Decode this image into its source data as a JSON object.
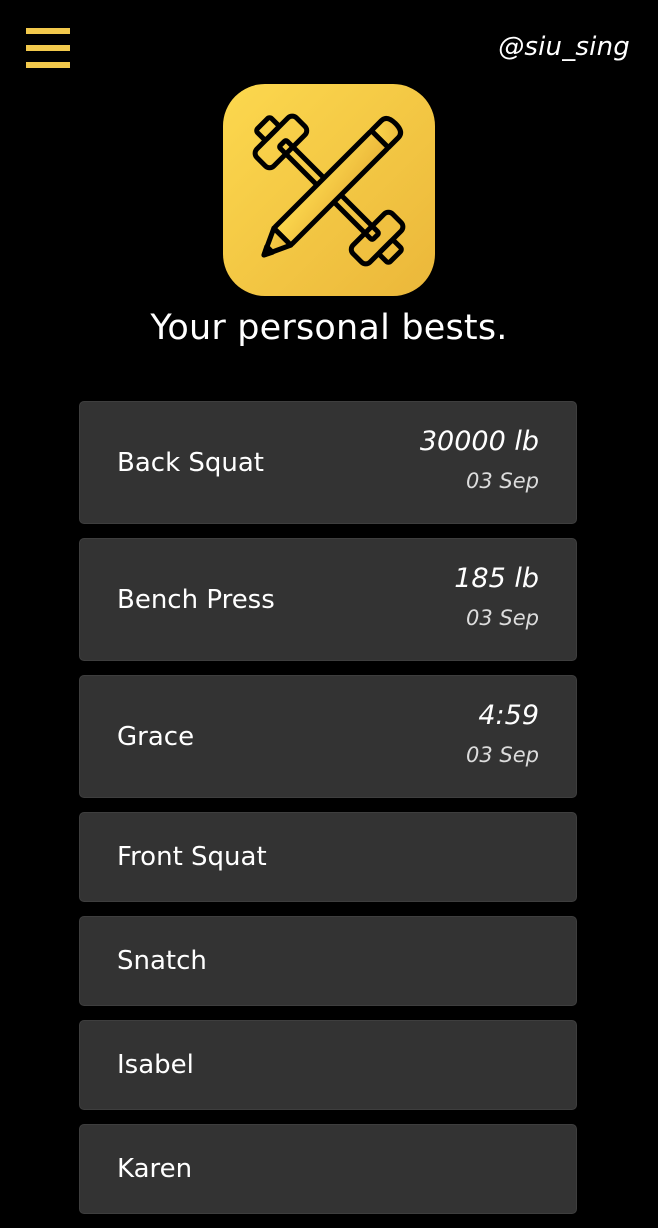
{
  "header": {
    "menu_icon": "hamburger-menu-icon",
    "username": "@siu_sing"
  },
  "logo": {
    "icon": "barbell-pencil-logo",
    "background_color": "#f2c94c",
    "stroke_color": "#000000"
  },
  "title": "Your personal bests.",
  "colors": {
    "background": "#000000",
    "card": "#333333",
    "accent": "#f2c94c",
    "text": "#ffffff"
  },
  "bests": [
    {
      "name": "Back Squat",
      "value": "30000 lb",
      "date": "03 Sep"
    },
    {
      "name": "Bench Press",
      "value": "185 lb",
      "date": "03 Sep"
    },
    {
      "name": "Grace",
      "value": "4:59",
      "date": "03 Sep"
    },
    {
      "name": "Front Squat"
    },
    {
      "name": "Snatch"
    },
    {
      "name": "Isabel"
    },
    {
      "name": "Karen"
    }
  ]
}
